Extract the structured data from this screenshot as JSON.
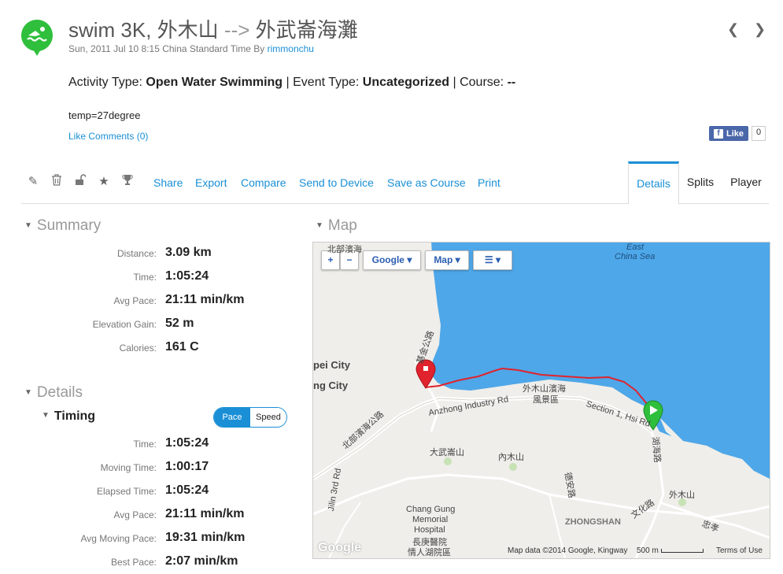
{
  "header": {
    "title_main": "swim 3K, 外木山",
    "title_arrow": "-->",
    "title_dest": "外武崙海灘",
    "date": "Sun, 2011 Jul 10 8:15 China Standard Time By",
    "author": "rimmonchu",
    "prev_icon": "chevron-left-icon",
    "next_icon": "chevron-right-icon",
    "logo_color": "#2fbf3c"
  },
  "activity": {
    "activity_type_label": "Activity Type:",
    "activity_type": "Open Water Swimming",
    "event_type_label": "| Event Type:",
    "event_type": "Uncategorized",
    "course_label": "| Course:",
    "course": "--",
    "description": "temp=27degree",
    "like_link": "Like",
    "comments_link": "Comments (0)",
    "fb_like_label": "Like",
    "fb_count": "0"
  },
  "toolbar": {
    "icons": [
      "pencil-icon",
      "trash-icon",
      "unlock-icon",
      "star-icon",
      "trophy-icon"
    ],
    "links": [
      "Share",
      "Export",
      "Compare",
      "Send to Device",
      "Save as Course",
      "Print"
    ],
    "tabs": [
      "Details",
      "Splits",
      "Player"
    ],
    "active_tab": "Details",
    "accent": "#1a8fd6"
  },
  "summary": {
    "heading": "Summary",
    "rows": [
      {
        "label": "Distance:",
        "value": "3.09 km"
      },
      {
        "label": "Time:",
        "value": "1:05:24"
      },
      {
        "label": "Avg Pace:",
        "value": "21:11 min/km"
      },
      {
        "label": "Elevation Gain:",
        "value": "52 m"
      },
      {
        "label": "Calories:",
        "value": "161 C"
      }
    ]
  },
  "details": {
    "heading": "Details",
    "timing_heading": "Timing",
    "toggle": {
      "pace": "Pace",
      "speed": "Speed",
      "selected": "Pace"
    },
    "rows": [
      {
        "label": "Time:",
        "value": "1:05:24"
      },
      {
        "label": "Moving Time:",
        "value": "1:00:17"
      },
      {
        "label": "Elapsed Time:",
        "value": "1:05:24"
      },
      {
        "label": "Avg Pace:",
        "value": "21:11 min/km"
      },
      {
        "label": "Avg Moving Pace:",
        "value": "19:31 min/km"
      },
      {
        "label": "Best Pace:",
        "value": "2:07 min/km"
      }
    ]
  },
  "map": {
    "heading": "Map",
    "zoom_in": "+",
    "zoom_out": "−",
    "provider": "Google",
    "map_type": "Map",
    "layers_icon": "layers-icon",
    "labels": {
      "east_china_sea_1": "East",
      "east_china_sea_2": "China Sea",
      "bay": "外木山濱海",
      "bay2": "風景區",
      "anzhong": "Anzhong Industry Rd",
      "section": "Section 1, Hsi Rd",
      "city1": "pei City",
      "city2": "ng City",
      "dawulun": "大武崙山",
      "neimushan": "內木山",
      "waimushan": "外木山",
      "hospital1": "Chang Gung",
      "hospital2": "Memorial",
      "hospital3": "Hospital",
      "hospital4": "長庚醫院",
      "hospital5": "情人湖院區",
      "zhongshan": "ZHONGSHAN",
      "wenhua": "文化路",
      "jilin": "Jilin 3rd Rd",
      "north": "北部濱海公路",
      "north2": "北部濱海",
      "jian": "基金公路",
      "zhongxiao": "忠孝",
      "desheng": "德安路",
      "huhai": "湖海路",
      "google_logo": "Google"
    },
    "attribution": "Map data ©2014 Google, Kingway",
    "scale": "500 m",
    "terms": "Terms of Use",
    "water_color": "#4ea7e8",
    "land_color": "#efeeea",
    "track_color": "#e0232d"
  }
}
